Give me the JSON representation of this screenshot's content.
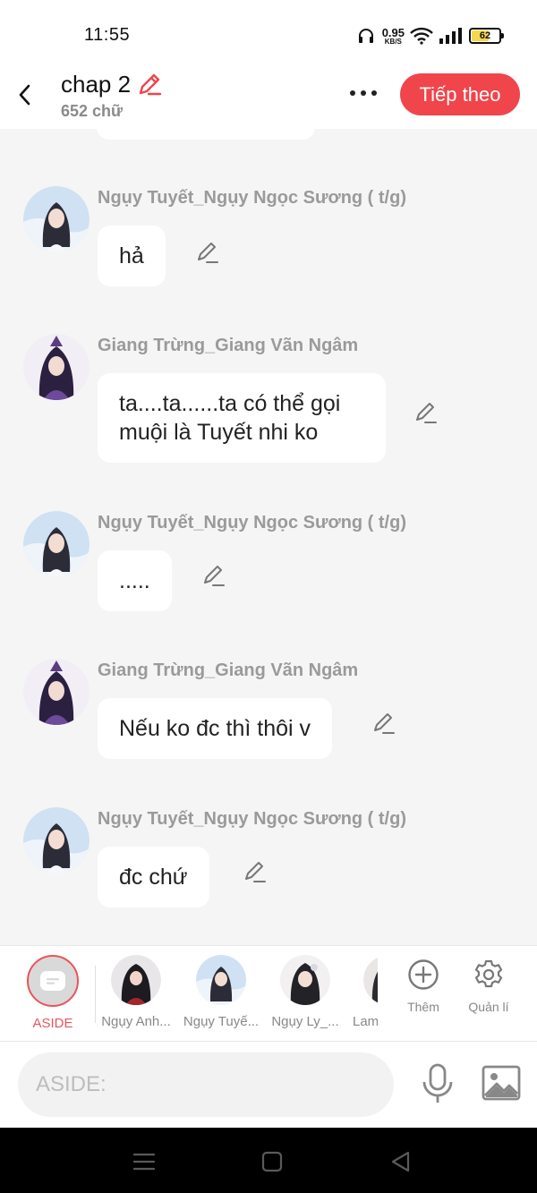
{
  "status_bar": {
    "time": "11:55",
    "net_speed_value": "0.95",
    "net_speed_unit": "KB/S",
    "battery_level": "62",
    "battery_percent": 62
  },
  "header": {
    "title": "chap 2",
    "word_count": "652 chữ",
    "next_label": "Tiếp theo",
    "accent_color": "#f0454b"
  },
  "chat": {
    "messages": [
      {
        "sender": "Ngụy Tuyết_Ngụy Ngọc Sương ( t/g)",
        "avatar": "character-avatar",
        "text": "hả"
      },
      {
        "sender": "Giang Trừng_Giang Vãn Ngâm",
        "avatar": "character-avatar",
        "text": "ta....ta......ta có thể gọi muội là Tuyết nhi ko"
      },
      {
        "sender": "Ngụy Tuyết_Ngụy Ngọc Sương ( t/g)",
        "avatar": "character-avatar",
        "text": "....."
      },
      {
        "sender": "Giang Trừng_Giang Vãn Ngâm",
        "avatar": "character-avatar",
        "text": "Nếu ko đc thì thôi v"
      },
      {
        "sender": "Ngụy Tuyết_Ngụy Ngọc Sương ( t/g)",
        "avatar": "character-avatar",
        "text": "đc chứ"
      }
    ]
  },
  "characters": {
    "aside": "ASIDE",
    "items": [
      {
        "name": "Ngụy Anh..."
      },
      {
        "name": "Ngụy Tuyế..."
      },
      {
        "name": "Ngụy Ly_..."
      },
      {
        "name": "Lam"
      }
    ],
    "add_label": "Thêm",
    "manage_label": "Quản lí"
  },
  "input": {
    "placeholder": "ASIDE:"
  }
}
